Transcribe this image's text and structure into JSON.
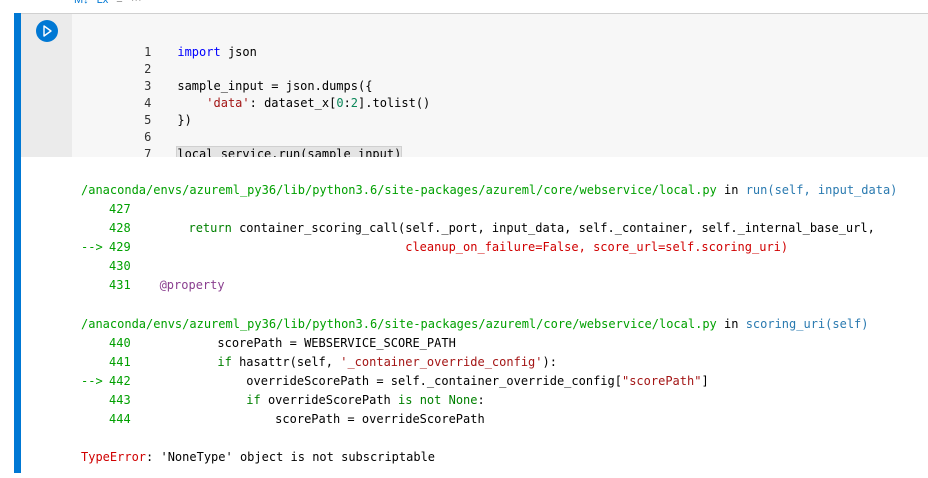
{
  "toolbar": {
    "md_label": "M↓",
    "clear_label": "Lx",
    "split_label": "≡",
    "more_label": "···"
  },
  "colors": {
    "accent": "#0078d4",
    "keyword": "#0000ff",
    "string": "#a31515",
    "number": "#098658",
    "path_green": "#00a000",
    "error_red": "#d00000"
  },
  "cell": {
    "run_icon": "play-icon",
    "lines": [
      {
        "n": "1",
        "text": "import json"
      },
      {
        "n": "2",
        "text": ""
      },
      {
        "n": "3",
        "text": "sample_input = json.dumps({"
      },
      {
        "n": "4",
        "text": "    'data': dataset_x[0:2].tolist()"
      },
      {
        "n": "5",
        "text": "})"
      },
      {
        "n": "6",
        "text": ""
      },
      {
        "n": "7",
        "text": "local_service.run(sample_input)"
      }
    ]
  },
  "output": {
    "frame1": {
      "path": "/anaconda/envs/azureml_py36/lib/python3.6/site-packages/azureml/core/webservice/local.py",
      "in_word": "in",
      "func": "run(self, input_data)",
      "lines": [
        {
          "arrow": "",
          "n": "427",
          "code": ""
        },
        {
          "arrow": "",
          "n": "428",
          "code": "        return container_scoring_call(self._port, input_data, self._container, self._internal_base_url,"
        },
        {
          "arrow": "-->",
          "n": "429",
          "code": "                                      cleanup_on_failure=False, score_url=self.scoring_uri)"
        },
        {
          "arrow": "",
          "n": "430",
          "code": ""
        },
        {
          "arrow": "",
          "n": "431",
          "code": "    @property"
        }
      ]
    },
    "frame2": {
      "path": "/anaconda/envs/azureml_py36/lib/python3.6/site-packages/azureml/core/webservice/local.py",
      "in_word": "in",
      "func": "scoring_uri(self)",
      "lines": [
        {
          "arrow": "",
          "n": "440",
          "code": "            scorePath = WEBSERVICE_SCORE_PATH"
        },
        {
          "arrow": "",
          "n": "441",
          "code": "            if hasattr(self, '_container_override_config'):"
        },
        {
          "arrow": "-->",
          "n": "442",
          "code": "                overrideScorePath = self._container_override_config[\"scorePath\"]"
        },
        {
          "arrow": "",
          "n": "443",
          "code": "                if overrideScorePath is not None:"
        },
        {
          "arrow": "",
          "n": "444",
          "code": "                    scorePath = overrideScorePath"
        }
      ]
    },
    "error_type": "TypeError",
    "error_message": ": 'NoneType' object is not subscriptable"
  }
}
